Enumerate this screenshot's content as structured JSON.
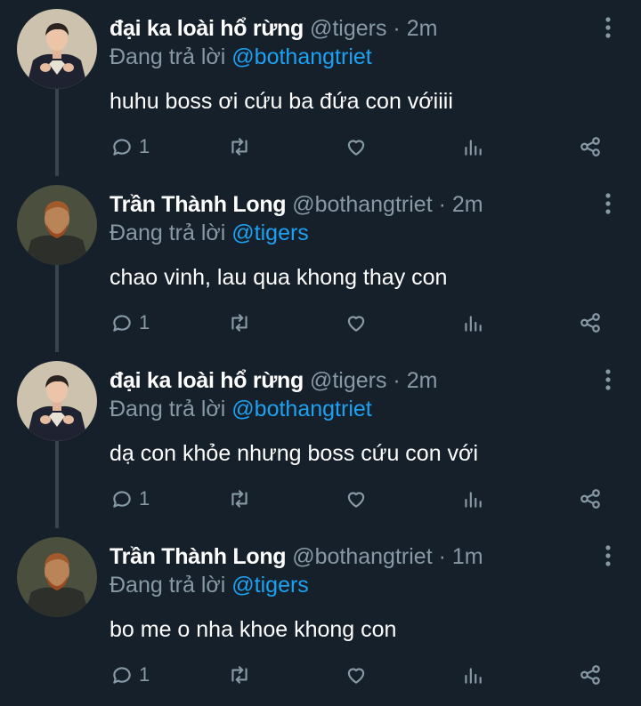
{
  "colors": {
    "background": "#15202b",
    "text": "#ffffff",
    "secondary": "#8899a6",
    "link": "#1da1f2",
    "thread_line": "#38444d"
  },
  "tweets": [
    {
      "name": "đại ka loài hổ rừng",
      "handle": "@tigers",
      "separator": "·",
      "time": "2m",
      "replying_prefix": "Đang trả lời",
      "replying_to": "@bothangtriet",
      "text": "huhu boss ơi cứu ba đứa con vớiiii",
      "reply_count": "1",
      "avatar": "young-man-avatar"
    },
    {
      "name": "Trần Thành Long",
      "handle": "@bothangtriet",
      "separator": "·",
      "time": "2m",
      "replying_prefix": "Đang trả lời",
      "replying_to": "@tigers",
      "text": "chao vinh, lau qua khong thay con",
      "reply_count": "1",
      "avatar": "painting-portrait-avatar"
    },
    {
      "name": "đại ka loài hổ rừng",
      "handle": "@tigers",
      "separator": "·",
      "time": "2m",
      "replying_prefix": "Đang trả lời",
      "replying_to": "@bothangtriet",
      "text": "dạ con khỏe nhưng boss cứu con với",
      "reply_count": "1",
      "avatar": "young-man-avatar"
    },
    {
      "name": "Trần Thành Long",
      "handle": "@bothangtriet",
      "separator": "·",
      "time": "1m",
      "replying_prefix": "Đang trả lời",
      "replying_to": "@tigers",
      "text": "bo me o nha khoe khong con",
      "reply_count": "1",
      "avatar": "painting-portrait-avatar"
    }
  ]
}
